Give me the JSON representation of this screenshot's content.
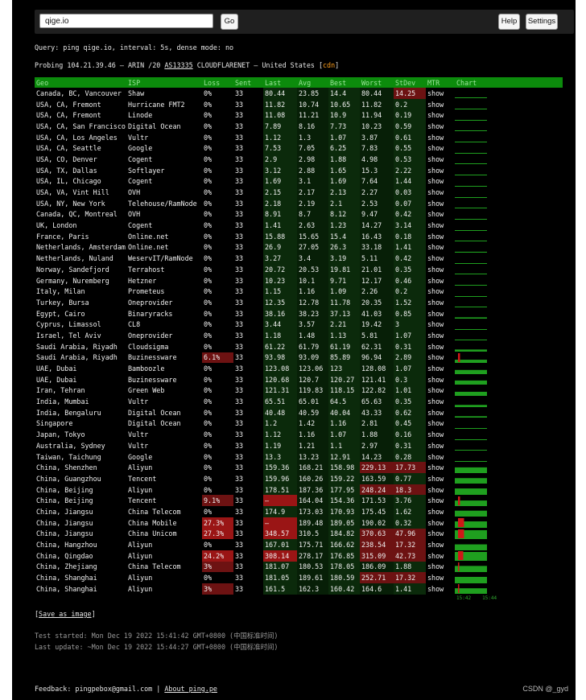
{
  "search": {
    "value": "qige.io"
  },
  "buttons": {
    "go": "Go",
    "help": "Help",
    "settings": "Settings"
  },
  "query_line": "Query: ping qige.io, interval: 5s, dense mode: no",
  "probe": {
    "prefix": "Probing 104.21.39.46 – ARIN /20 ",
    "asn": "AS13335",
    "middle": " CLOUDFLARENET – United States [",
    "tag": "cdn",
    "suffix": "]"
  },
  "columns": [
    "Geo",
    "ISP",
    "Loss",
    "Sent",
    "Last",
    "Avg",
    "Best",
    "Worst",
    "StDev",
    "MTR",
    "Chart"
  ],
  "colors": {
    "header_bg": "#0c8b0c",
    "loss_bad": "#6d1212",
    "loss_worse": "#9a1515",
    "link": "#45c145",
    "cdn": "#ff9f1c"
  },
  "rows": [
    [
      "Canada, BC, Vancouver",
      "Shaw",
      "0%",
      "33",
      "80.44",
      "23.85",
      "14.4",
      "80.44",
      "14.25",
      "show"
    ],
    [
      "USA, CA, Fremont",
      "Hurricane FMT2",
      "0%",
      "33",
      "11.82",
      "10.74",
      "10.65",
      "11.82",
      "0.2",
      "show"
    ],
    [
      "USA, CA, Fremont",
      "Linode",
      "0%",
      "33",
      "11.08",
      "11.21",
      "10.9",
      "11.94",
      "0.19",
      "show"
    ],
    [
      "USA, CA, San Francisco",
      "Digital Ocean",
      "0%",
      "33",
      "7.89",
      "8.16",
      "7.73",
      "10.23",
      "0.59",
      "show"
    ],
    [
      "USA, CA, Los Angeles",
      "Vultr",
      "0%",
      "33",
      "1.12",
      "1.3",
      "1.07",
      "3.87",
      "0.61",
      "show"
    ],
    [
      "USA, CA, Seattle",
      "Google",
      "0%",
      "33",
      "7.53",
      "7.05",
      "6.25",
      "7.83",
      "0.55",
      "show"
    ],
    [
      "USA, CO, Denver",
      "Cogent",
      "0%",
      "33",
      "2.9",
      "2.98",
      "1.88",
      "4.98",
      "0.53",
      "show"
    ],
    [
      "USA, TX, Dallas",
      "Softlayer",
      "0%",
      "33",
      "3.12",
      "2.88",
      "1.65",
      "15.3",
      "2.22",
      "show"
    ],
    [
      "USA, IL, Chicago",
      "Cogent",
      "0%",
      "33",
      "1.69",
      "3.1",
      "1.69",
      "7.64",
      "1.44",
      "show"
    ],
    [
      "USA, VA, Vint Hill",
      "OVH",
      "0%",
      "33",
      "2.15",
      "2.17",
      "2.13",
      "2.27",
      "0.03",
      "show"
    ],
    [
      "USA, NY, New York",
      "Telehouse/RamNode",
      "0%",
      "33",
      "2.18",
      "2.19",
      "2.1",
      "2.53",
      "0.07",
      "show"
    ],
    [
      "Canada, QC, Montreal",
      "OVH",
      "0%",
      "33",
      "8.91",
      "8.7",
      "8.12",
      "9.47",
      "0.42",
      "show"
    ],
    [
      "UK, London",
      "Cogent",
      "0%",
      "33",
      "1.41",
      "2.63",
      "1.23",
      "14.27",
      "3.14",
      "show"
    ],
    [
      "France, Paris",
      "Online.net",
      "0%",
      "33",
      "15.88",
      "15.65",
      "15.4",
      "16.43",
      "0.18",
      "show"
    ],
    [
      "Netherlands, Amsterdam",
      "Online.net",
      "0%",
      "33",
      "26.9",
      "27.05",
      "26.3",
      "33.18",
      "1.41",
      "show"
    ],
    [
      "Netherlands, Nuland",
      "WeservIT/RamNode",
      "0%",
      "33",
      "3.27",
      "3.4",
      "3.19",
      "5.11",
      "0.42",
      "show"
    ],
    [
      "Norway, Sandefjord",
      "Terrahost",
      "0%",
      "33",
      "20.72",
      "20.53",
      "19.81",
      "21.01",
      "0.35",
      "show"
    ],
    [
      "Germany, Nuremberg",
      "Hetzner",
      "0%",
      "33",
      "10.23",
      "10.1",
      "9.71",
      "12.17",
      "0.46",
      "show"
    ],
    [
      "Italy, Milan",
      "Prometeus",
      "0%",
      "33",
      "1.15",
      "1.16",
      "1.09",
      "2.26",
      "0.2",
      "show"
    ],
    [
      "Turkey, Bursa",
      "Oneprovider",
      "0%",
      "33",
      "12.35",
      "12.78",
      "11.78",
      "20.35",
      "1.52",
      "show"
    ],
    [
      "Egypt, Cairo",
      "Binaryracks",
      "0%",
      "33",
      "38.16",
      "38.23",
      "37.13",
      "41.03",
      "0.85",
      "show"
    ],
    [
      "Cyprus, Limassol",
      "CL8",
      "0%",
      "33",
      "3.44",
      "3.57",
      "2.21",
      "19.42",
      "3",
      "show"
    ],
    [
      "Israel, Tel Aviv",
      "Oneprovider",
      "0%",
      "33",
      "1.18",
      "1.48",
      "1.13",
      "5.81",
      "1.07",
      "show"
    ],
    [
      "Saudi Arabia, Riyadh",
      "Cloudsigma",
      "0%",
      "33",
      "61.22",
      "61.79",
      "61.19",
      "62.31",
      "0.31",
      "show"
    ],
    [
      "Saudi Arabia, Riyadh",
      "Buzinessware",
      "6.1%",
      "33",
      "93.98",
      "93.09",
      "85.89",
      "96.94",
      "2.89",
      "show"
    ],
    [
      "UAE, Dubai",
      "Bamboozle",
      "0%",
      "33",
      "123.08",
      "123.06",
      "123",
      "128.08",
      "1.07",
      "show"
    ],
    [
      "UAE, Dubai",
      "Buzinessware",
      "0%",
      "33",
      "120.68",
      "120.7",
      "120.27",
      "121.41",
      "0.3",
      "show"
    ],
    [
      "Iran, Tehran",
      "Green Web",
      "0%",
      "33",
      "121.31",
      "119.83",
      "118.15",
      "122.82",
      "1.01",
      "show"
    ],
    [
      "India, Mumbai",
      "Vultr",
      "0%",
      "33",
      "65.51",
      "65.01",
      "64.5",
      "65.63",
      "0.35",
      "show"
    ],
    [
      "India, Bengaluru",
      "Digital Ocean",
      "0%",
      "33",
      "40.48",
      "40.59",
      "40.04",
      "43.33",
      "0.62",
      "show"
    ],
    [
      "Singapore",
      "Digital Ocean",
      "0%",
      "33",
      "1.2",
      "1.42",
      "1.16",
      "2.81",
      "0.45",
      "show"
    ],
    [
      "Japan, Tokyo",
      "Vultr",
      "0%",
      "33",
      "1.12",
      "1.16",
      "1.07",
      "1.88",
      "0.16",
      "show"
    ],
    [
      "Australia, Sydney",
      "Vultr",
      "0%",
      "33",
      "1.19",
      "1.21",
      "1.1",
      "2.97",
      "0.31",
      "show"
    ],
    [
      "Taiwan, Taichung",
      "Google",
      "0%",
      "33",
      "13.3",
      "13.23",
      "12.91",
      "14.23",
      "0.28",
      "show"
    ],
    [
      "China, Shenzhen",
      "Aliyun",
      "0%",
      "33",
      "159.36",
      "168.21",
      "158.98",
      "229.13",
      "17.73",
      "show"
    ],
    [
      "China, Guangzhou",
      "Tencent",
      "0%",
      "33",
      "159.96",
      "160.26",
      "159.22",
      "163.59",
      "0.77",
      "show"
    ],
    [
      "China, Beijing",
      "Aliyun",
      "0%",
      "33",
      "178.51",
      "187.36",
      "177.95",
      "248.24",
      "18.3",
      "show"
    ],
    [
      "China, Beijing",
      "Tencent",
      "9.1%",
      "33",
      "–",
      "164.04",
      "154.36",
      "171.53",
      "3.76",
      "show"
    ],
    [
      "China, Jiangsu",
      "China Telecom",
      "0%",
      "33",
      "174.9",
      "173.03",
      "170.93",
      "175.45",
      "1.62",
      "show"
    ],
    [
      "China, Jiangsu",
      "China Mobile",
      "27.3%",
      "33",
      "–",
      "189.48",
      "189.05",
      "190.02",
      "0.32",
      "show"
    ],
    [
      "China, Jiangsu",
      "China Unicom",
      "27.3%",
      "33",
      "348.57",
      "310.5",
      "184.82",
      "370.63",
      "47.96",
      "show"
    ],
    [
      "China, Hangzhou",
      "Aliyun",
      "0%",
      "33",
      "167.01",
      "175.71",
      "166.62",
      "238.54",
      "17.32",
      "show"
    ],
    [
      "China, Qingdao",
      "Aliyun",
      "24.2%",
      "33",
      "308.14",
      "278.17",
      "176.85",
      "315.09",
      "42.73",
      "show"
    ],
    [
      "China, Zhejiang",
      "China Telecom",
      "3%",
      "33",
      "181.07",
      "180.53",
      "178.05",
      "186.09",
      "1.88",
      "show"
    ],
    [
      "China, Shanghai",
      "Aliyun",
      "0%",
      "33",
      "181.05",
      "189.61",
      "180.59",
      "252.71",
      "17.32",
      "show"
    ],
    [
      "China, Shanghai",
      "Aliyun",
      "3%",
      "33",
      "161.5",
      "162.3",
      "160.42",
      "164.6",
      "1.41",
      "show"
    ]
  ],
  "chart_axis": [
    "15:42",
    "15:44"
  ],
  "save_label": "Save as image",
  "test_started": "Test started: Mon Dec 19 2022 15:41:42 GMT+0800 (中国标准时间)",
  "last_update": "Last update: ~Mon Dec 19 2022 15:44:27 GMT+0800 (中国标准时间)",
  "feedback": {
    "prefix": "Feedback: pingpebox@gmail.com | ",
    "link": "About ping.pe"
  },
  "watermark": "CSDN @_gyd"
}
